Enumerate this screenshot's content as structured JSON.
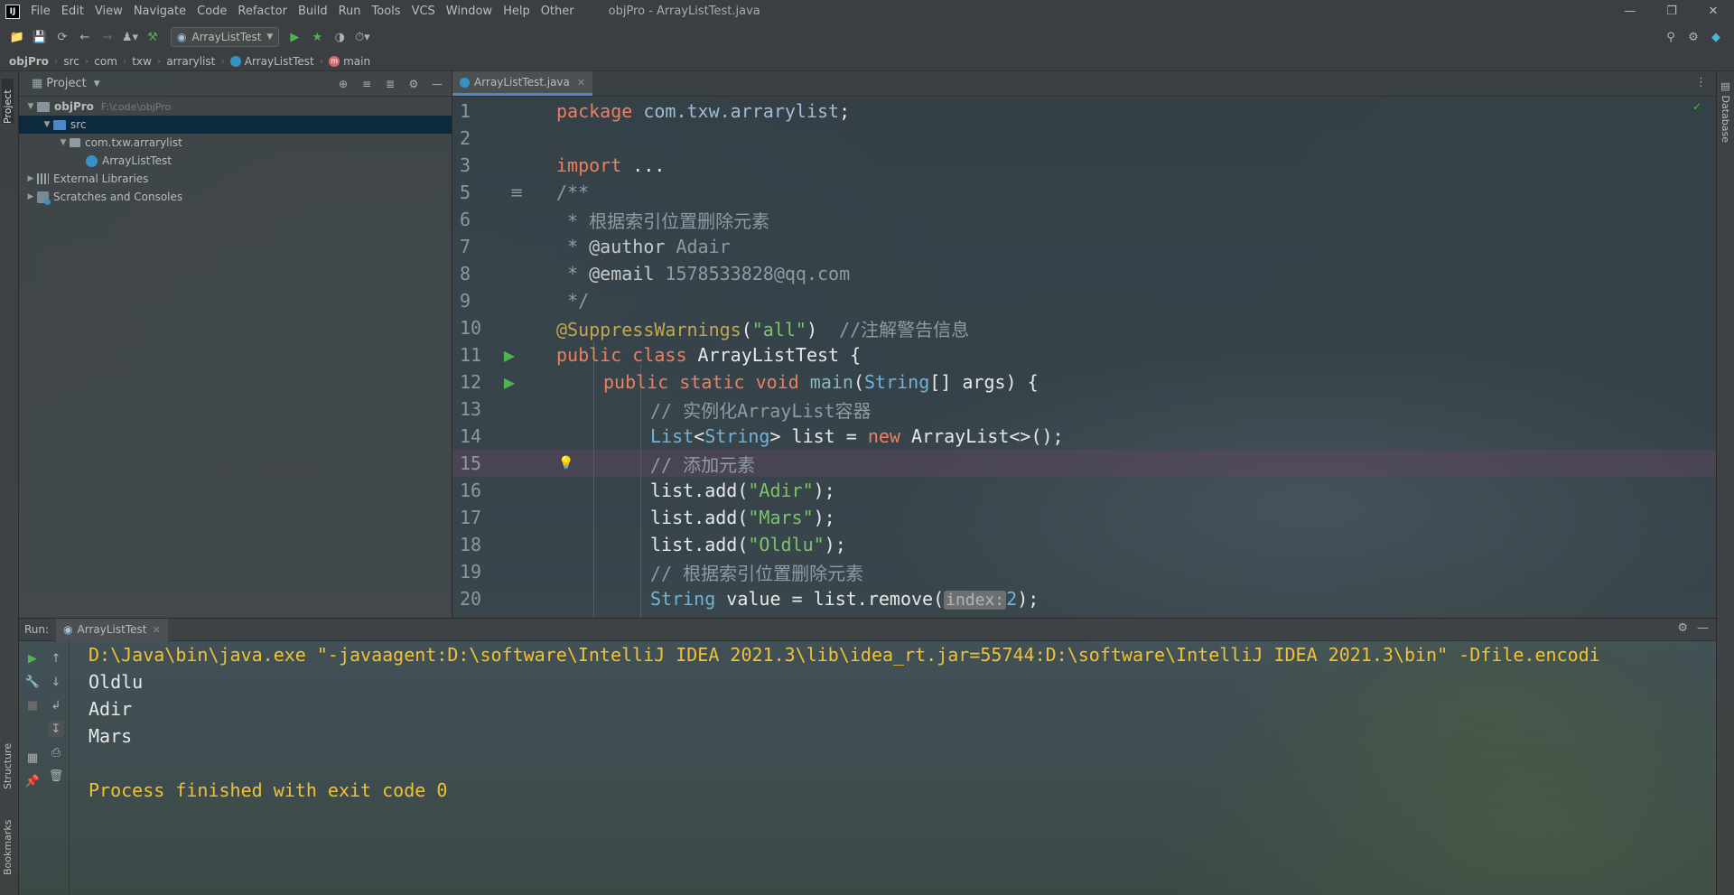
{
  "window": {
    "title": "objPro - ArrayListTest.java",
    "logo": "IJ"
  },
  "menu": [
    "File",
    "Edit",
    "View",
    "Navigate",
    "Code",
    "Refactor",
    "Build",
    "Run",
    "Tools",
    "VCS",
    "Window",
    "Help",
    "Other"
  ],
  "toolbar": {
    "run_config": "ArrayListTest"
  },
  "breadcrumb": [
    "objPro",
    "src",
    "com",
    "txw",
    "arrarylist",
    "ArrayListTest",
    "main"
  ],
  "left_strip": {
    "project_tab": "Project",
    "structure_tab": "Structure",
    "bookmarks_tab": "Bookmarks"
  },
  "right_strip": {
    "database_tab": "Database"
  },
  "project_panel": {
    "title": "Project",
    "tree": [
      {
        "label": "objPro",
        "path": "F:\\code\\objPro"
      },
      {
        "label": "src"
      },
      {
        "label": "com.txw.arrarylist"
      },
      {
        "label": "ArrayListTest"
      },
      {
        "label": "External Libraries"
      },
      {
        "label": "Scratches and Consoles"
      }
    ]
  },
  "editor": {
    "tab": "ArrayListTest.java",
    "line_numbers": [
      "1",
      "2",
      "3",
      "5",
      "6",
      "7",
      "8",
      "9",
      "10",
      "11",
      "12",
      "13",
      "14",
      "15",
      "16",
      "17",
      "18",
      "19",
      "20"
    ],
    "lines": {
      "l1_kw": "package",
      "l1_pkg": " com.txw.arrarylist",
      "l1_end": ";",
      "l3_kw": "import",
      "l3_rest": " ...",
      "l5": "/**",
      "l6": " * 根据索引位置删除元素",
      "l7_pre": " * ",
      "l7_tag": "@author",
      "l7_val": " Adair",
      "l8_pre": " * ",
      "l8_tag": "@email",
      "l8_val": " 1578533828@qq.com",
      "l9": " */",
      "l10_ann": "@SuppressWarnings",
      "l10_open": "(",
      "l10_str": "\"all\"",
      "l10_close": ")",
      "l10_cmt": "  //注解警告信息",
      "l11_kw": "public class",
      "l11_rest": " ArrayListTest {",
      "l12_kw": "public static void",
      "l12_fn": " main",
      "l12_open": "(",
      "l12_typ": "String",
      "l12_rest": "[] args) {",
      "l13": "// 实例化ArrayList容器",
      "l14_typ1": "List",
      "l14_lt": "<",
      "l14_typ2": "String",
      "l14_mid": "> list = ",
      "l14_kw": "new",
      "l14_rest": " ArrayList<>();",
      "l15": "// 添加元素",
      "l16_pre": "list.add(",
      "l16_str": "\"Adir\"",
      "l16_end": ");",
      "l17_pre": "list.add(",
      "l17_str": "\"Mars\"",
      "l17_end": ");",
      "l18_pre": "list.add(",
      "l18_str": "\"Oldlu\"",
      "l18_end": ");",
      "l19": "// 根据索引位置删除元素",
      "l20_typ": "String",
      "l20_mid": " value = list.remove(",
      "l20_hint": "index:",
      "l20_num": "2",
      "l20_end": ");"
    }
  },
  "run_panel": {
    "label": "Run:",
    "tab": "ArrayListTest",
    "console": [
      "D:\\Java\\bin\\java.exe \"-javaagent:D:\\software\\IntelliJ IDEA 2021.3\\lib\\idea_rt.jar=55744:D:\\software\\IntelliJ IDEA 2021.3\\bin\" -Dfile.encodi",
      "Oldlu",
      "Adir",
      "Mars",
      "",
      "Process finished with exit code 0"
    ]
  },
  "colors": {
    "keyword": "#ee7f5e",
    "string": "#7dc46b",
    "comment": "#8f9aa2",
    "annotation": "#c2a84b",
    "type": "#6fb3d9",
    "console_system": "#f0c232"
  }
}
